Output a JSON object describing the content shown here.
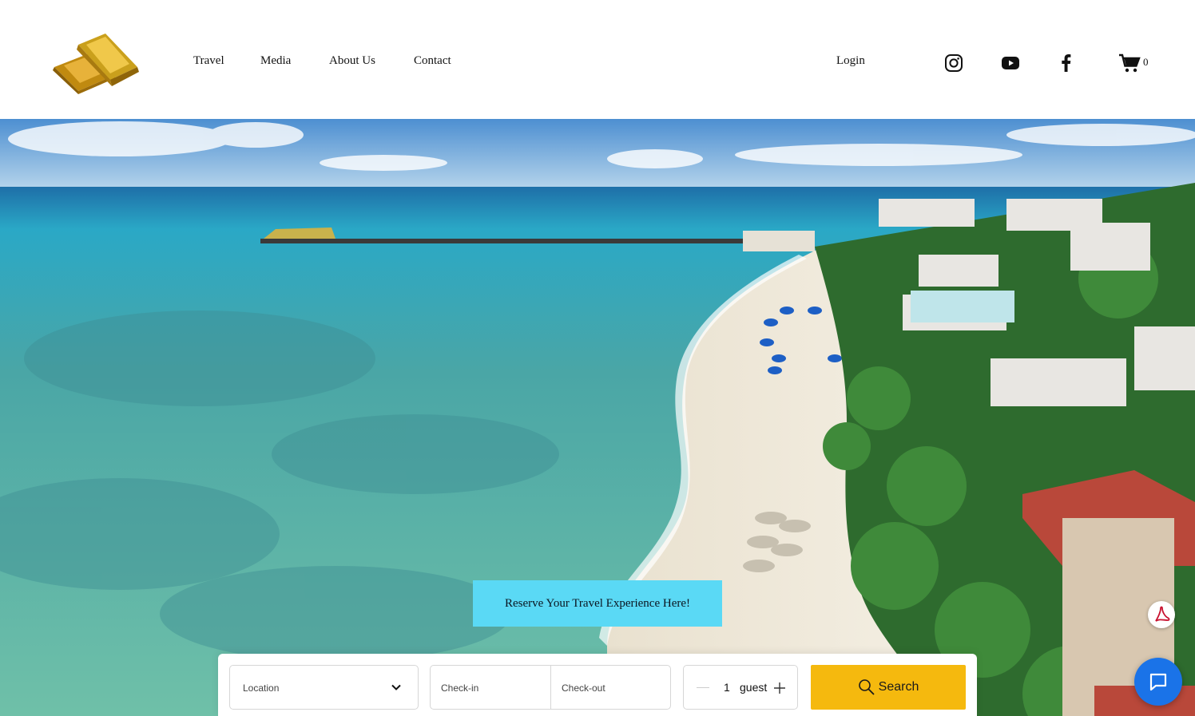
{
  "header": {
    "logo_alt": "gold bars logo",
    "nav": [
      {
        "label": "Travel"
      },
      {
        "label": "Media"
      },
      {
        "label": "About Us"
      },
      {
        "label": "Contact"
      }
    ],
    "login_label": "Login",
    "social": [
      {
        "icon": "instagram-icon"
      },
      {
        "icon": "youtube-icon"
      },
      {
        "icon": "facebook-icon"
      }
    ],
    "cart": {
      "icon": "cart-icon",
      "count": "0"
    }
  },
  "hero": {
    "cta_label": "Reserve Your Travel Experience Here!"
  },
  "booking": {
    "location_label": "Location",
    "checkin_label": "Check-in",
    "checkout_label": "Check-out",
    "guest_count": "1",
    "guest_label": "guest",
    "search_label": "Search"
  },
  "colors": {
    "cta_bg": "#5ad9f5",
    "search_bg": "#f5b90e",
    "chat_bg": "#1a73e8"
  }
}
